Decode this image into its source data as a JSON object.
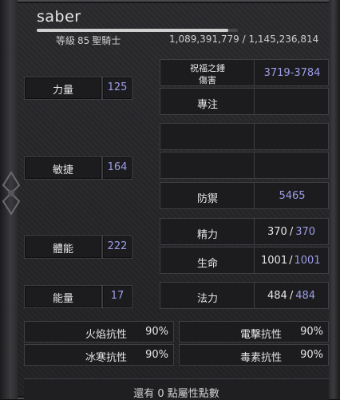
{
  "character": {
    "name": "saber",
    "level_label": "等級",
    "level": "85",
    "class": "聖騎士",
    "exp_text": "1,089,391,779 / 1,145,236,814",
    "exp_fraction": 0.951
  },
  "attributes": [
    {
      "label": "力量",
      "value": "125"
    },
    {
      "label": "敏捷",
      "value": "164"
    },
    {
      "label": "體能",
      "value": "222"
    },
    {
      "label": "能量",
      "value": "17"
    }
  ],
  "stats": {
    "weapon_label_line1": "祝福之錘",
    "weapon_label_line2": "傷害",
    "weapon_damage": "3719-3784",
    "focus_label": "專注",
    "defense_label": "防禦",
    "defense": "5465",
    "stamina_label": "精力",
    "stamina_current": "370",
    "stamina_max": "370",
    "life_label": "生命",
    "life_current": "1001",
    "life_max": "1001",
    "mana_label": "法力",
    "mana_current": "484",
    "mana_max": "484",
    "separator": "/"
  },
  "resistances": [
    {
      "label": "火焰抗性",
      "value": "90%"
    },
    {
      "label": "電擊抗性",
      "value": "90%"
    },
    {
      "label": "冰寒抗性",
      "value": "90%"
    },
    {
      "label": "毒素抗性",
      "value": "90%"
    }
  ],
  "footer": {
    "text": "還有 0 點屬性點數"
  }
}
